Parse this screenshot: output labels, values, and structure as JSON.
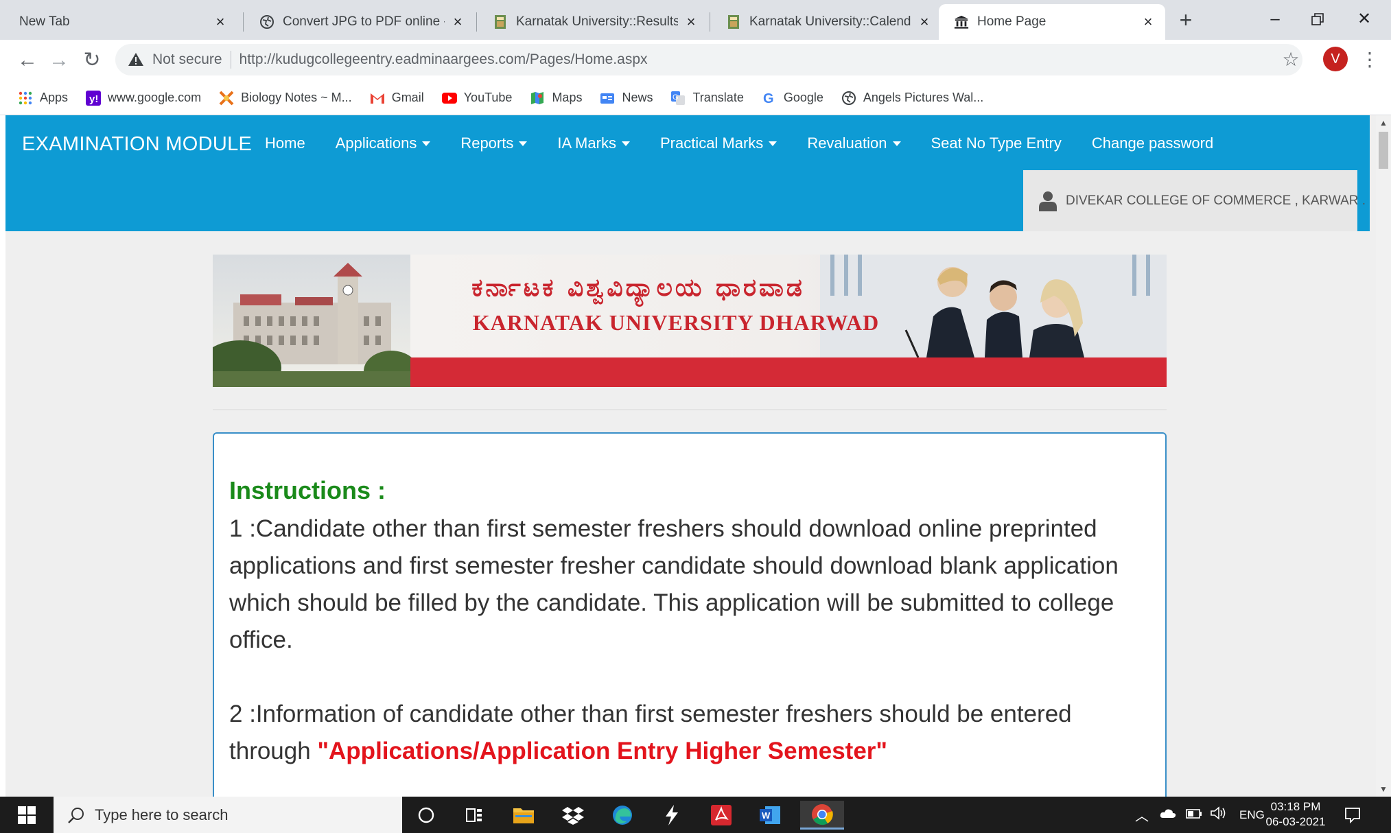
{
  "browser": {
    "tabs": [
      {
        "title": "New Tab",
        "icon": "none",
        "active": false
      },
      {
        "title": "Convert JPG to PDF online - co",
        "icon": "globe-icon",
        "active": false
      },
      {
        "title": "Karnatak University::Results",
        "icon": "university-favicon",
        "active": false
      },
      {
        "title": "Karnatak University::Calendar c",
        "icon": "university-favicon",
        "active": false
      },
      {
        "title": "Home Page",
        "icon": "building-icon",
        "active": true
      }
    ],
    "new_tab": "+",
    "address": {
      "security": "Not secure",
      "url": "http://kudugcollegeentry.eadminaargees.com/Pages/Home.aspx"
    },
    "profile_initial": "V",
    "bookmarks": [
      {
        "label": "Apps",
        "icon": "apps-grid-icon"
      },
      {
        "label": "www.google.com",
        "icon": "yahoo-icon"
      },
      {
        "label": "Biology Notes ~ M...",
        "icon": "biology-icon"
      },
      {
        "label": "Gmail",
        "icon": "gmail-icon"
      },
      {
        "label": "YouTube",
        "icon": "youtube-icon"
      },
      {
        "label": "Maps",
        "icon": "maps-icon"
      },
      {
        "label": "News",
        "icon": "news-icon"
      },
      {
        "label": "Translate",
        "icon": "translate-icon"
      },
      {
        "label": "Google",
        "icon": "google-icon"
      },
      {
        "label": "Angels Pictures Wal...",
        "icon": "globe-icon"
      }
    ]
  },
  "site": {
    "brand": "EXAMINATION MODULE",
    "nav": [
      {
        "label": "Home",
        "dropdown": false
      },
      {
        "label": "Applications",
        "dropdown": true
      },
      {
        "label": "Reports",
        "dropdown": true
      },
      {
        "label": "IA Marks",
        "dropdown": true
      },
      {
        "label": "Practical Marks",
        "dropdown": true
      },
      {
        "label": "Revaluation",
        "dropdown": true
      },
      {
        "label": "Seat No Type Entry",
        "dropdown": false
      },
      {
        "label": "Change password",
        "dropdown": false
      }
    ],
    "user": "DIVEKAR COLLEGE OF COMMERCE , KARWAR .",
    "banner": {
      "kannada_title": "ಕರ್ನಾಟಕ ವಿಶ್ವವಿದ್ಯಾಲಯ ಧಾರವಾಡ",
      "english_title": "KARNATAK UNIVERSITY DHARWAD"
    },
    "instructions": {
      "heading": "Instructions :",
      "item1": "1 :Candidate other than first semester freshers should download online preprinted applications and first semester fresher candidate should download blank application which should be filled by the candidate. This application will be submitted to college office.",
      "item2_prefix": "2 :Information of candidate other than first semester freshers should be entered through ",
      "item2_highlight": "\"Applications/Application Entry Higher Semester\""
    },
    "colors": {
      "navbar": "#0e9bd4",
      "heading_green": "#1a8a1a",
      "highlight_red": "#e3141c",
      "banner_red": "#d42a36"
    }
  },
  "taskbar": {
    "search_placeholder": "Type here to search",
    "pinned": [
      "cortana-icon",
      "task-view-icon",
      "file-explorer-icon",
      "dropbox-icon",
      "edge-icon",
      "winamp-icon",
      "acrobat-icon",
      "word-icon",
      "chrome-icon"
    ],
    "language": "ENG",
    "time": "03:18 PM",
    "date": "06-03-2021"
  }
}
